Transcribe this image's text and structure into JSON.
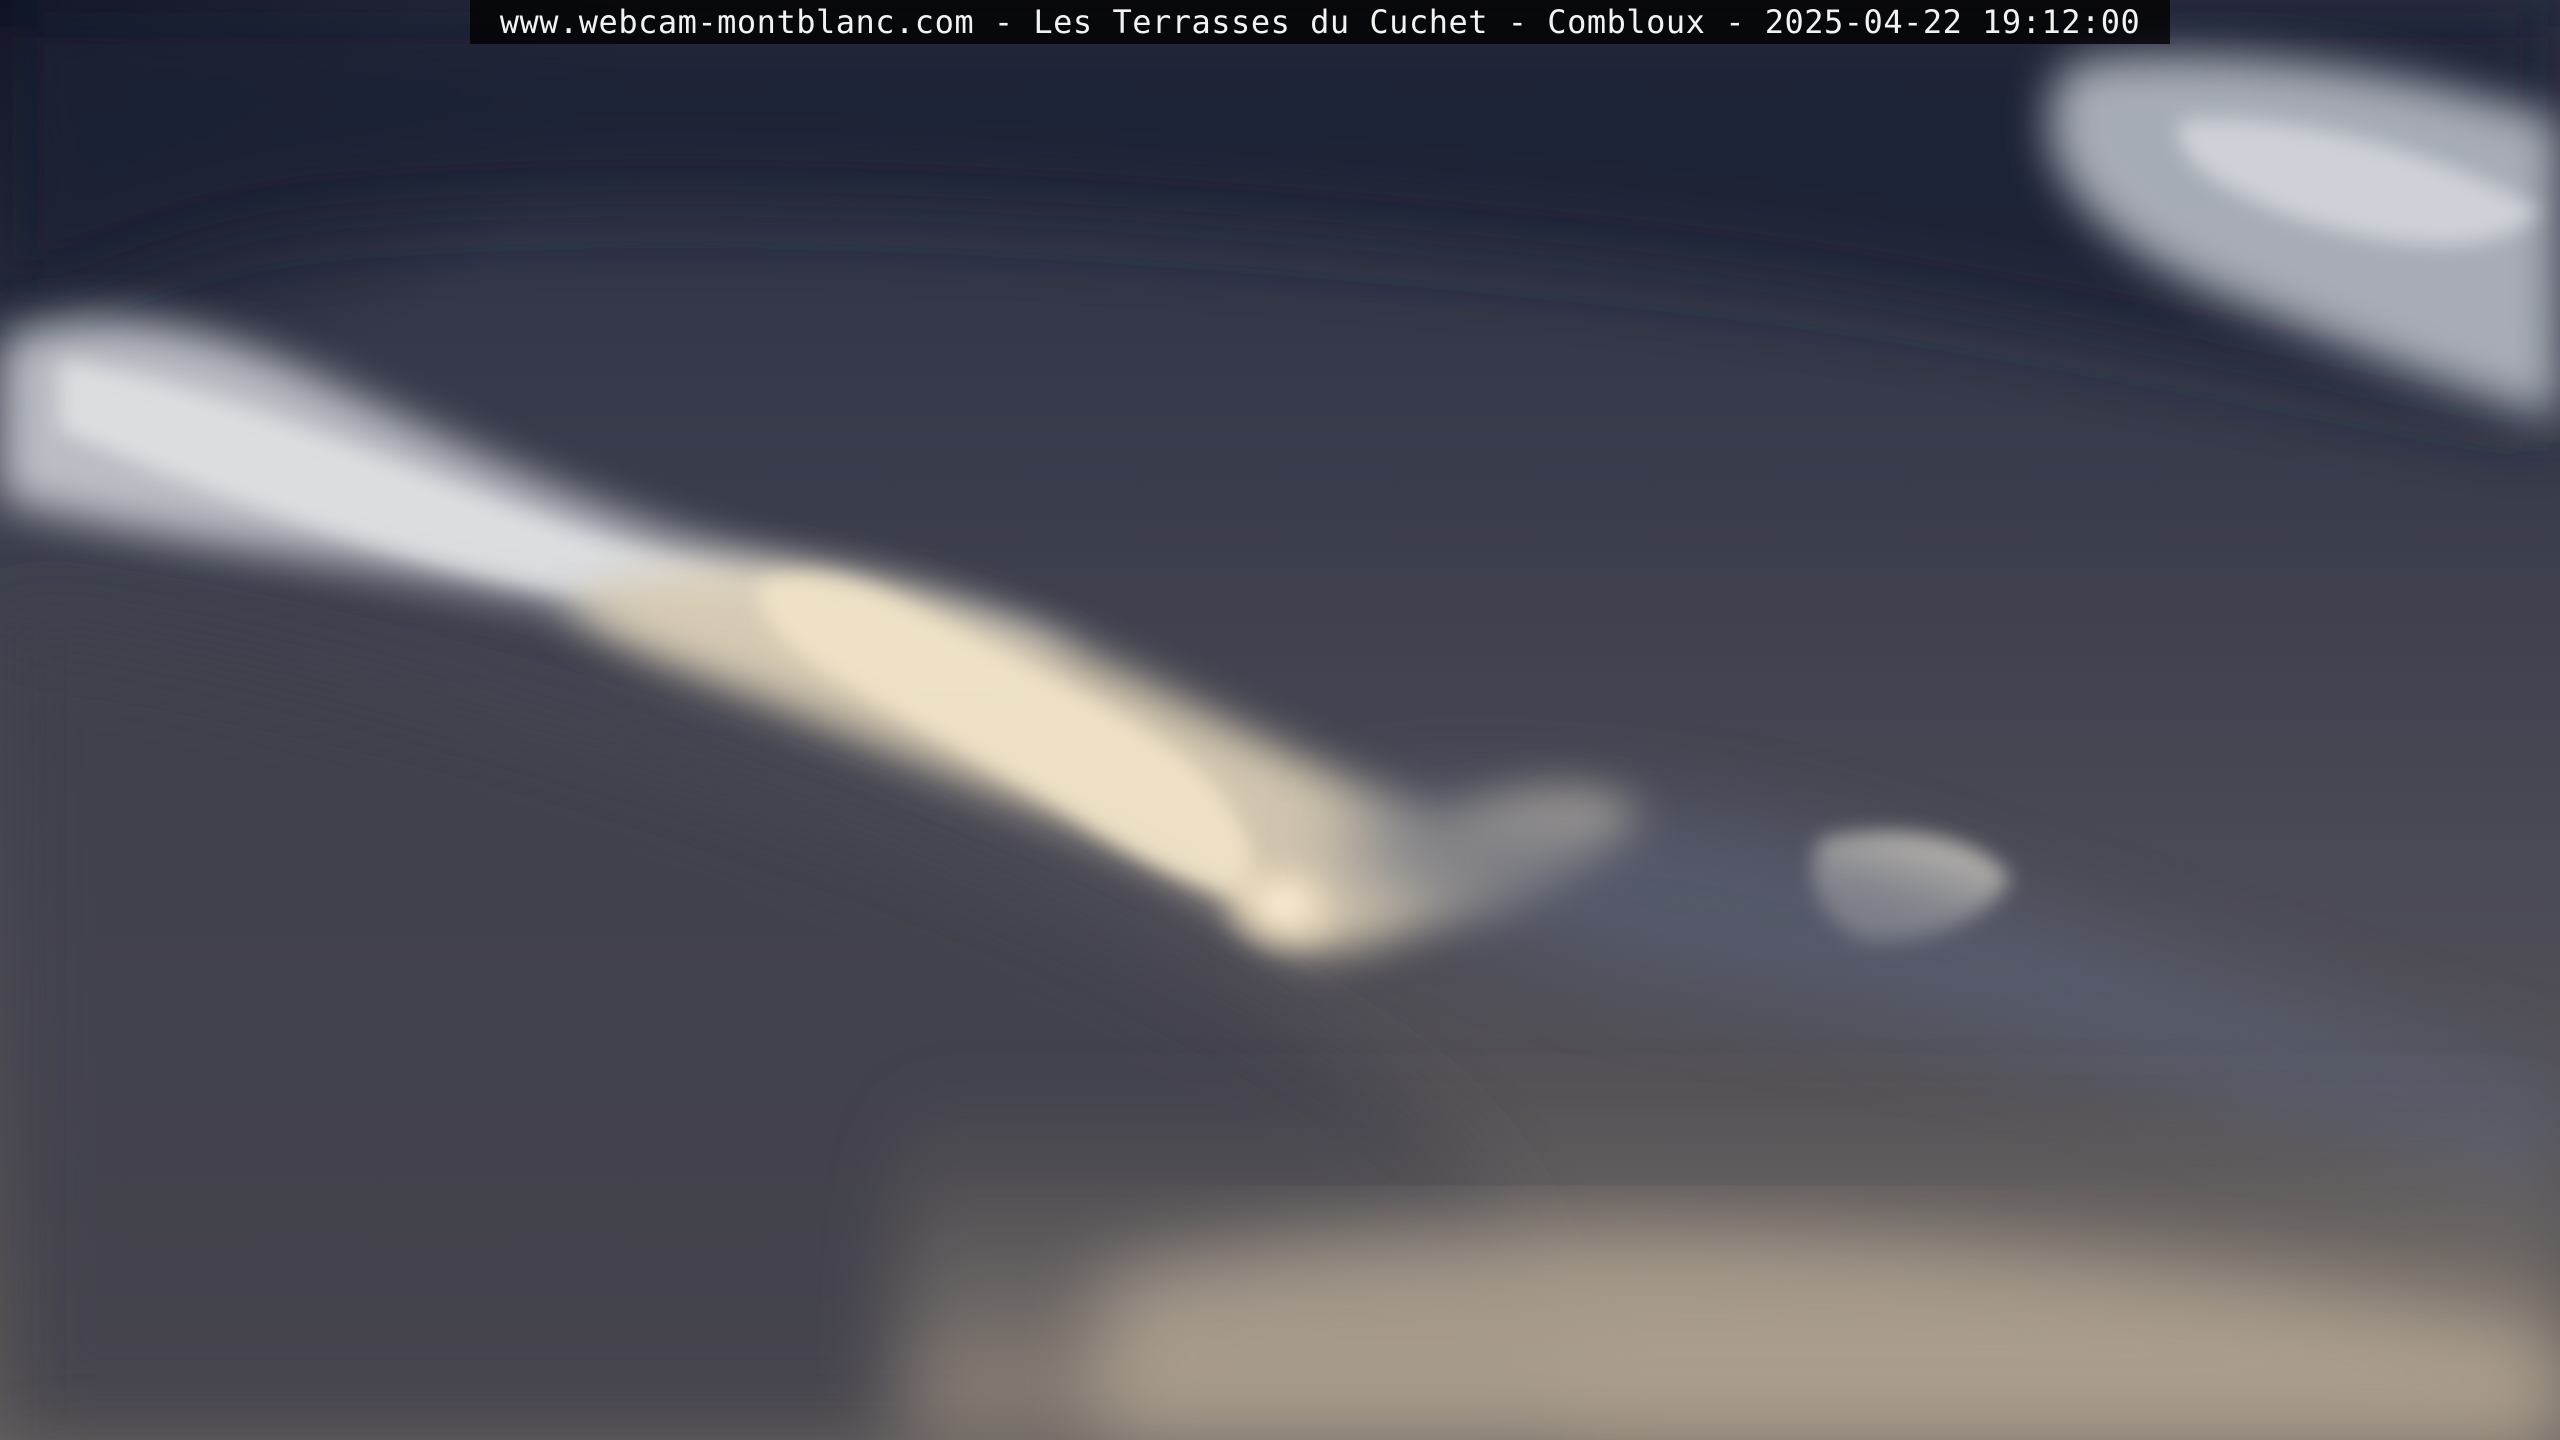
{
  "webcam": {
    "caption": "www.webcam-montblanc.com - Les Terrasses du Cuchet - Combloux - 2025-04-22 19:12:00"
  },
  "scene": {
    "colors": {
      "sky_dark": "#0a0f24",
      "cloud_dark": "#3a3d4c",
      "cloud_mid": "#6b6c75",
      "cloud_light": "#d8dbe0",
      "sunlit_cloud": "#f1e4c8"
    }
  }
}
